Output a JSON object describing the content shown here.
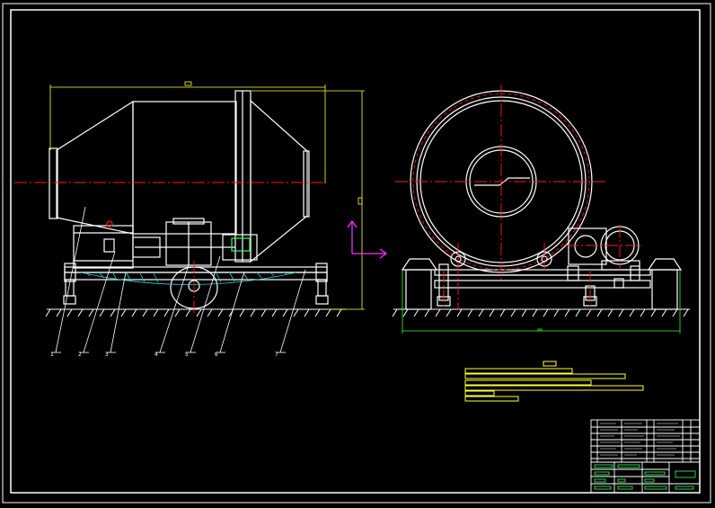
{
  "canvas": {
    "background": "#000000"
  },
  "colors": {
    "outline": "#ffffff",
    "centerline": "#ff1a1a",
    "dimension": "#ffff33",
    "axis_marker": "#ff33ff",
    "base_dimension": "#33ff33",
    "hatch": "#33cccc",
    "titleblock_green": "#33ff66"
  },
  "views": [
    {
      "name": "side-elevation",
      "label": ""
    },
    {
      "name": "end-elevation",
      "label": ""
    }
  ],
  "leaders": [
    {
      "number": "1"
    },
    {
      "number": "2"
    },
    {
      "number": "3"
    },
    {
      "number": "4"
    },
    {
      "number": "5"
    },
    {
      "number": "6"
    },
    {
      "number": "7"
    }
  ],
  "notes": {
    "heading": "",
    "lines": [
      "",
      "",
      "",
      "",
      ""
    ]
  },
  "title_block": {
    "drawing_title": "",
    "drawing_number": "",
    "scale": "",
    "sheet": ""
  }
}
